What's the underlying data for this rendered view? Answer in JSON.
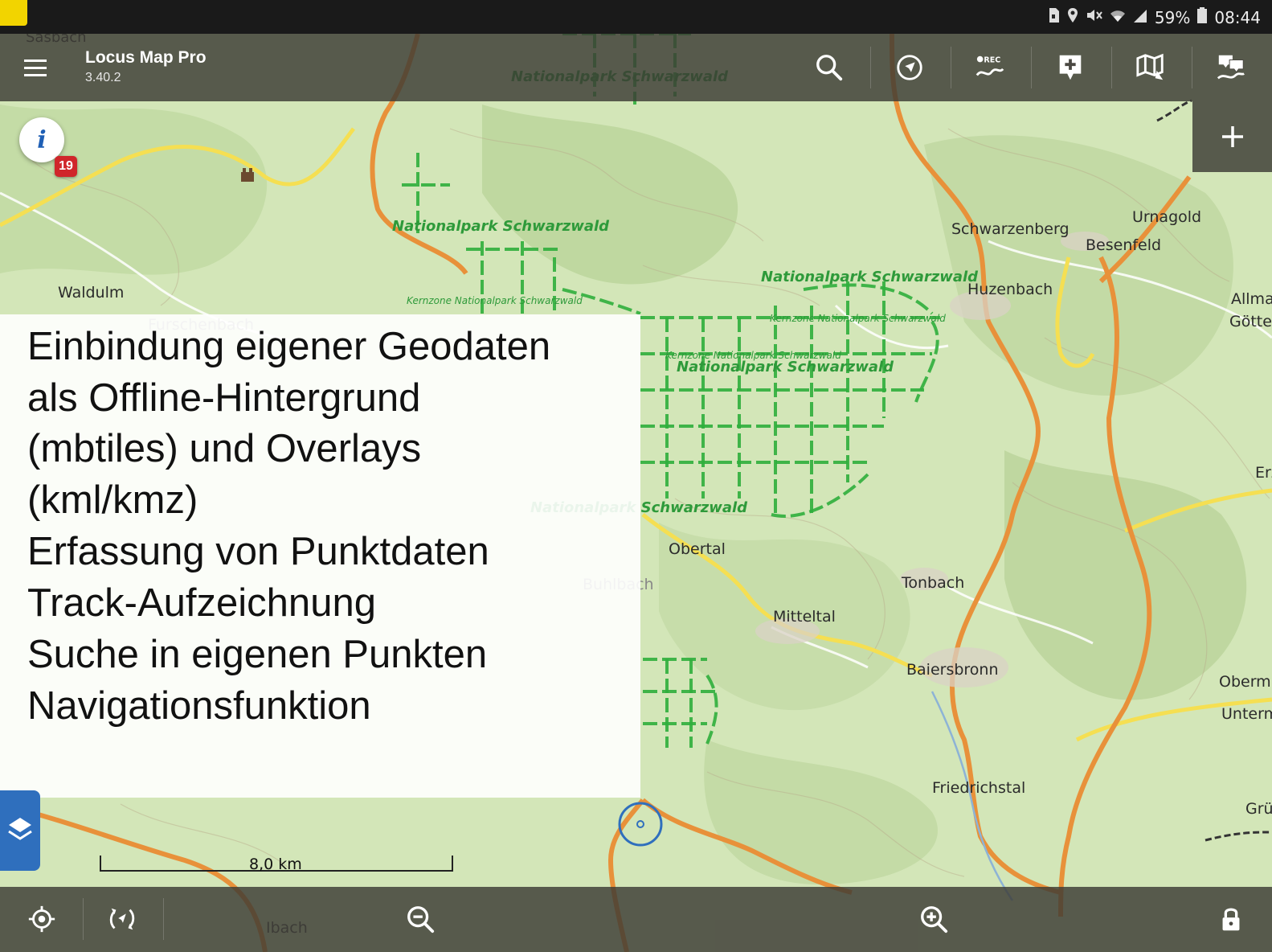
{
  "status_bar": {
    "battery": "59%",
    "time": "08:44",
    "icons": [
      "sd-card-icon",
      "location-icon",
      "mute-icon",
      "wifi-icon",
      "signal-icon",
      "battery-icon"
    ]
  },
  "app_bar": {
    "title": "Locus Map Pro",
    "version": "3.40.2",
    "actions": [
      "search-icon",
      "compass-icon",
      "track-record-icon",
      "add-point-icon",
      "map-manager-icon",
      "data-manager-icon"
    ],
    "rec_label": "REC"
  },
  "map": {
    "top_left_place": "Sasbach",
    "places": [
      "Waldulm",
      "Furschenbach",
      "Schwarzenberg",
      "Urnagold",
      "Besenfeld",
      "Huzenbach",
      "Allma",
      "Göttel",
      "Erz",
      "Obertal",
      "Buhlbach",
      "Tonbach",
      "Mitteltal",
      "Baiersbronn",
      "Obermu",
      "Unterm",
      "Friedrichstal",
      "Grü",
      "Ibach"
    ],
    "park_labels": [
      "Nationalpark Schwarzwald",
      "Nationalpark Schwarzwald",
      "Nationalpark Schwarzwald",
      "Nationalpark Schwarzwald",
      "Nationalpark Schwarzwald"
    ],
    "core_zone_labels": [
      "Kernzone Nationalpark Schwarzwald",
      "Kernzone Nationalpark Schwarzwald",
      "Kernzone Nationalpark Schwarzwald"
    ],
    "info_badge": "19",
    "scale_label": "8,0 km"
  },
  "overlay_lines": [
    "Einbindung eigener Geodaten",
    "als Offline-Hintergrund",
    "(mbtiles) und Overlays",
    "(kml/kmz)",
    "Erfassung von Punktdaten",
    "Track-Aufzeichnung",
    "Suche in eigenen Punkten",
    "Navigationsfunktion"
  ],
  "colors": {
    "map_bg": "#d3e6b8",
    "road_orange": "#e8913a",
    "road_yellow": "#f5df52",
    "park_green": "#2fae3c",
    "bar_bg": "#3c3a34",
    "accent_blue": "#2f6fbd"
  },
  "bottom_bar": [
    "my-location-icon",
    "rotate-map-icon",
    "zoom-out-icon",
    "zoom-in-icon",
    "lock-icon"
  ]
}
